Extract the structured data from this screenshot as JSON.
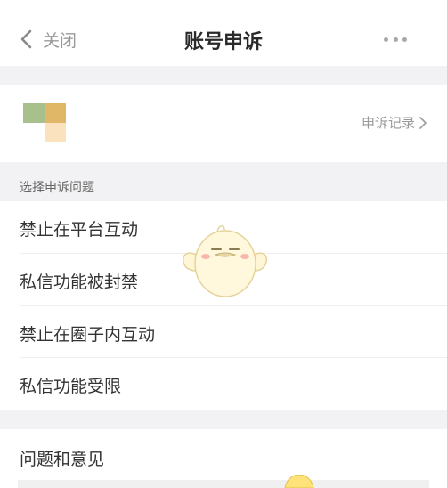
{
  "header": {
    "back_label": "关闭",
    "title": "账号申诉"
  },
  "account": {
    "record_label": "申诉记录"
  },
  "section": {
    "header": "选择申诉问题"
  },
  "issues": [
    {
      "label": "禁止在平台互动"
    },
    {
      "label": "私信功能被封禁"
    },
    {
      "label": "禁止在圈子内互动"
    },
    {
      "label": "私信功能受限"
    }
  ],
  "feedback": {
    "label": "问题和意见"
  },
  "colors": {
    "background": "#ffffff",
    "separator": "#f2f2f4",
    "primary_text": "#333333",
    "secondary_text": "#9a9a9a"
  },
  "icons": {
    "back": "chevron-left-icon",
    "more": "more-dots-icon",
    "record": "chevron-right-icon",
    "mascot": "mascot-sticker"
  }
}
